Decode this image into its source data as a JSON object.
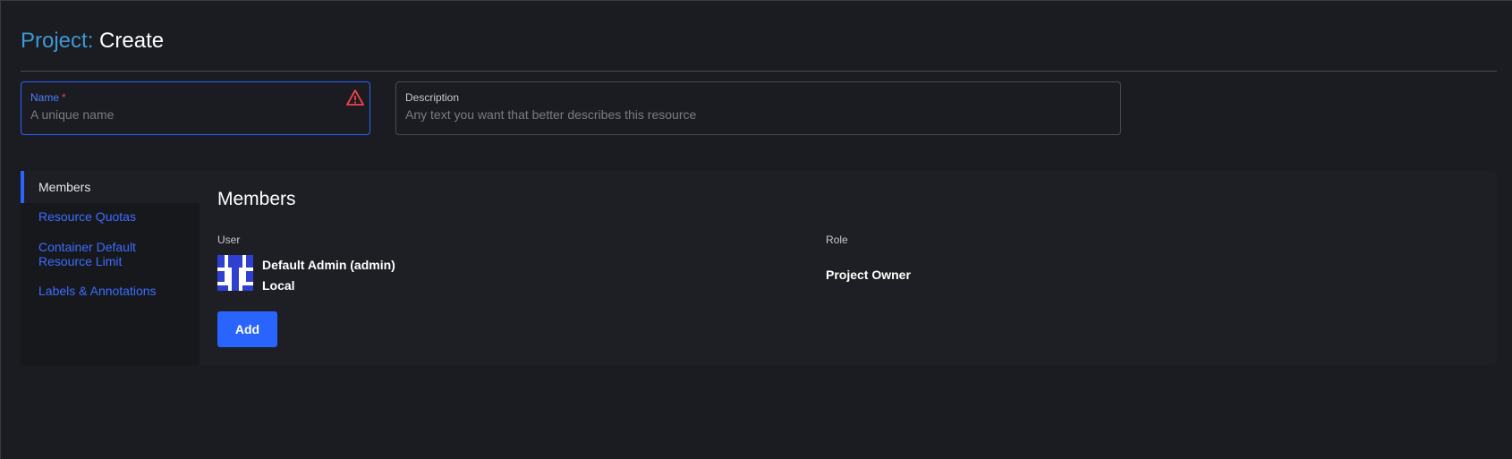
{
  "header": {
    "prefix": "Project:",
    "title": "Create"
  },
  "form": {
    "name": {
      "label": "Name",
      "required_mark": "*",
      "value": "",
      "placeholder": "A unique name",
      "icon": "warning-icon"
    },
    "description": {
      "label": "Description",
      "value": "",
      "placeholder": "Any text you want that better describes this resource"
    }
  },
  "sidenav": {
    "items": [
      {
        "label": "Members",
        "active": true
      },
      {
        "label": "Resource Quotas"
      },
      {
        "label": "Container Default Resource Limit"
      },
      {
        "label": "Labels & Annotations"
      }
    ]
  },
  "members": {
    "heading": "Members",
    "columns": {
      "user": "User",
      "role": "Role"
    },
    "rows": [
      {
        "name": "Default Admin (admin)",
        "provider": "Local",
        "role": "Project Owner"
      }
    ],
    "add_label": "Add"
  },
  "colors": {
    "accent": "#2a64ff",
    "title_prefix": "#3d98d3",
    "warning": "#f0434d",
    "background": "#1b1c21"
  }
}
